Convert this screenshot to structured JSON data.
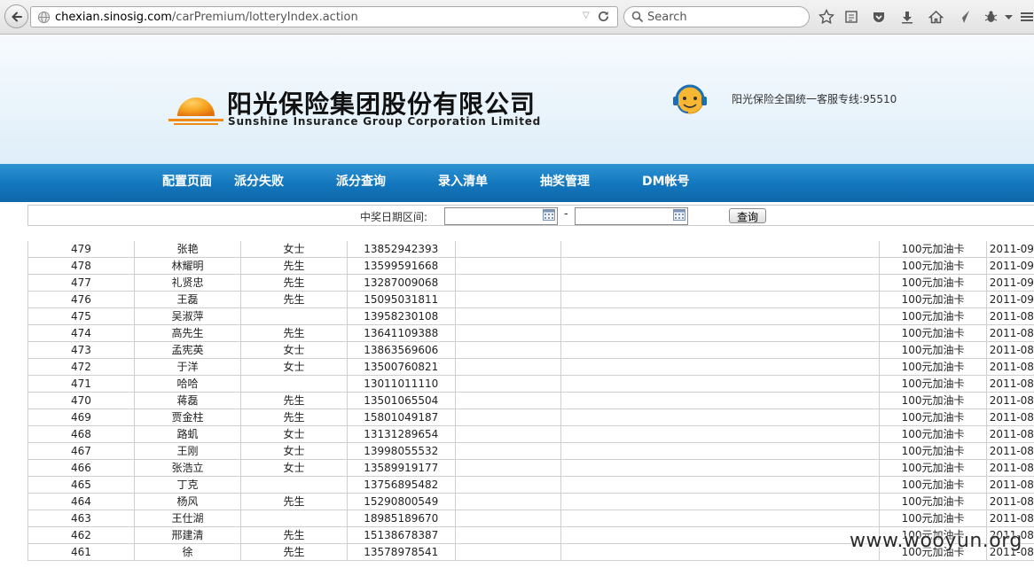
{
  "browser": {
    "url_host": "chexian.sinosig.com",
    "url_path": "/carPremium/lotteryIndex.action",
    "search_placeholder": "Search"
  },
  "header": {
    "brand_cn": "阳光保险集团股份有限公司",
    "brand_en": "Sunshine Insurance Group Corporation Limited",
    "hotline": "阳光保险全国统一客服专线:95510"
  },
  "nav": {
    "items": [
      "配置页面",
      "派分失败",
      "派分查询",
      "录入清单",
      "抽奖管理",
      "DM帐号"
    ]
  },
  "filter": {
    "label": "中奖日期区间:",
    "separator": "-",
    "start_value": "",
    "end_value": "",
    "query_label": "查询"
  },
  "table": {
    "rows": [
      [
        "479",
        "张艳",
        "女士",
        "13852942393",
        "100元加油卡",
        "2011-09"
      ],
      [
        "478",
        "林耀明",
        "先生",
        "13599591668",
        "100元加油卡",
        "2011-09"
      ],
      [
        "477",
        "礼贤忠",
        "先生",
        "13287009068",
        "100元加油卡",
        "2011-09"
      ],
      [
        "476",
        "王磊",
        "先生",
        "15095031811",
        "100元加油卡",
        "2011-09"
      ],
      [
        "475",
        "吴淑萍",
        "",
        "13958230108",
        "100元加油卡",
        "2011-08"
      ],
      [
        "474",
        "高先生",
        "先生",
        "13641109388",
        "100元加油卡",
        "2011-08"
      ],
      [
        "473",
        "孟宪英",
        "女士",
        "13863569606",
        "100元加油卡",
        "2011-08"
      ],
      [
        "472",
        "于洋",
        "女士",
        "13500760821",
        "100元加油卡",
        "2011-08"
      ],
      [
        "471",
        "哈哈",
        "",
        "13011011110",
        "100元加油卡",
        "2011-08"
      ],
      [
        "470",
        "蒋磊",
        "先生",
        "13501065504",
        "100元加油卡",
        "2011-08"
      ],
      [
        "469",
        "贾金柱",
        "先生",
        "15801049187",
        "100元加油卡",
        "2011-08"
      ],
      [
        "468",
        "路虮",
        "女士",
        "13131289654",
        "100元加油卡",
        "2011-08"
      ],
      [
        "467",
        "王刚",
        "女士",
        "13998055532",
        "100元加油卡",
        "2011-08"
      ],
      [
        "466",
        "张浩立",
        "女士",
        "13589919177",
        "100元加油卡",
        "2011-08"
      ],
      [
        "465",
        "丁克",
        "",
        "13756895482",
        "100元加油卡",
        "2011-08"
      ],
      [
        "464",
        "杨风",
        "先生",
        "15290800549",
        "100元加油卡",
        "2011-08"
      ],
      [
        "463",
        "王仕湖",
        "",
        "18985189670",
        "100元加油卡",
        "2011-08"
      ],
      [
        "462",
        "邢建清",
        "先生",
        "15138678387",
        "100元加油卡",
        "2011-08"
      ],
      [
        "461",
        "徐",
        "先生",
        "13578978541",
        "100元加油卡",
        "2011-08"
      ]
    ]
  },
  "watermark": "www.wooyun.org",
  "colors": {
    "nav_blue": "#1376bd",
    "logo_orange": "#f39a1e"
  }
}
